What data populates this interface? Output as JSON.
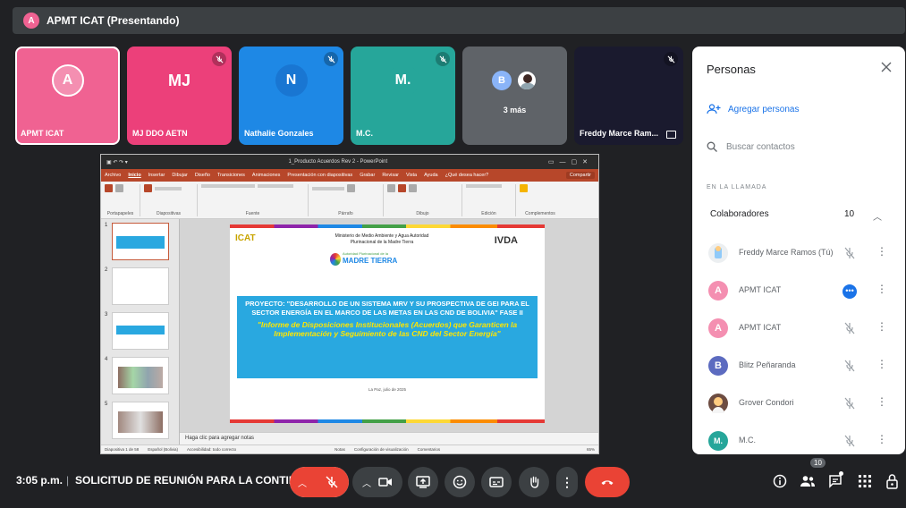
{
  "presenter_bar": {
    "avatar_letter": "A",
    "title": "APMT ICAT (Presentando)"
  },
  "tiles": [
    {
      "label": "APMT ICAT",
      "initials": "A",
      "bg": "#f06292",
      "circle": "#f48fb1",
      "muted": false,
      "active": true
    },
    {
      "label": "MJ DDO AETN",
      "initials": "MJ",
      "bg": "#ec407a",
      "circle": "#ec407a",
      "muted": true,
      "active": false
    },
    {
      "label": "Nathalie Gonzales",
      "initials": "N",
      "bg": "#1e88e5",
      "circle": "#1976d2",
      "muted": true,
      "active": false
    },
    {
      "label": "M.C.",
      "initials": "M.",
      "bg": "#26a69a",
      "circle": "#26a69a",
      "muted": true,
      "active": false
    },
    {
      "label": "3 más",
      "initials": "B",
      "bg": "#5f6368",
      "circle": "#8ab4f8",
      "muted": false,
      "active": false
    },
    {
      "label": "Freddy Marce Ram...",
      "initials": "",
      "bg": "#1a1a2e",
      "circle": "#1a1a2e",
      "muted": true,
      "active": false
    }
  ],
  "powerpoint": {
    "doc_title": "1_Producto Acuerdos Rev 2 - PowerPoint",
    "menu": [
      "Archivo",
      "Inicio",
      "Insertar",
      "Dibujar",
      "Diseño",
      "Transiciones",
      "Animaciones",
      "Presentación con diapositivas",
      "Grabar",
      "Revisar",
      "Vista",
      "Ayuda",
      "¿Qué desea hacer?"
    ],
    "share_label": "Compartir",
    "ribbon_groups": [
      "Portapapeles",
      "Diapositivas",
      "Fuente",
      "Párrafo",
      "Dibujo",
      "Edición",
      "Complementos"
    ],
    "thumb_numbers": [
      "1",
      "2",
      "3",
      "4",
      "5"
    ],
    "slide": {
      "logo_left": "ICAT",
      "ministry": "Ministerio de Medio Ambiente y Agua Autoridad Plurinacional de la Madre Tierra",
      "logo_right": "IVDA",
      "madre_small": "Autoridad Plurinacional de la",
      "madre": "MADRE TIERRA",
      "project": "PROYECTO: \"DESARROLLO DE UN SISTEMA MRV Y SU PROSPECTIVA DE GEI PARA EL SECTOR ENERGÍA EN EL MARCO DE LAS METAS EN LAS CND DE BOLIVIA\" FASE II",
      "subtitle": "\"Informe de Disposiciones Institucionales (Acuerdos) que Garanticen la Implementación y Seguimiento de las CND del Sector Energía\"",
      "date": "La Paz, julio de 2025"
    },
    "notes": "Haga clic para agregar notas",
    "status": [
      "Diapositiva 1 de 58",
      "Español (Bolivia)",
      "Accesibilidad: todo correcto",
      "Notas",
      "Configuración de visualización",
      "Comentarios",
      "65%"
    ]
  },
  "people_panel": {
    "title": "Personas",
    "add_label": "Agregar personas",
    "search_placeholder": "Buscar contactos",
    "in_call": "EN LA LLAMADA",
    "section": "Colaboradores",
    "count": "10",
    "people": [
      {
        "name": "Freddy Marce Ramos (Tú)",
        "initial": "",
        "color": "#d7ccc8",
        "state": "muted"
      },
      {
        "name": "APMT ICAT",
        "initial": "A",
        "color": "#f48fb1",
        "state": "speaking"
      },
      {
        "name": "APMT ICAT",
        "initial": "A",
        "color": "#f48fb1",
        "state": "muted"
      },
      {
        "name": "Blitz Peñaranda",
        "initial": "B",
        "color": "#5c6bc0",
        "state": "muted"
      },
      {
        "name": "Grover Condori",
        "initial": "",
        "color": "#6d4c41",
        "state": "muted"
      },
      {
        "name": "M.C.",
        "initial": "M.",
        "color": "#26a69a",
        "state": "muted"
      }
    ]
  },
  "bottom_bar": {
    "time": "3:05 p.m.",
    "separator": "|",
    "meeting": "SOLICITUD DE REUNIÓN PARA LA CONTINUI...",
    "people_badge": "10"
  }
}
